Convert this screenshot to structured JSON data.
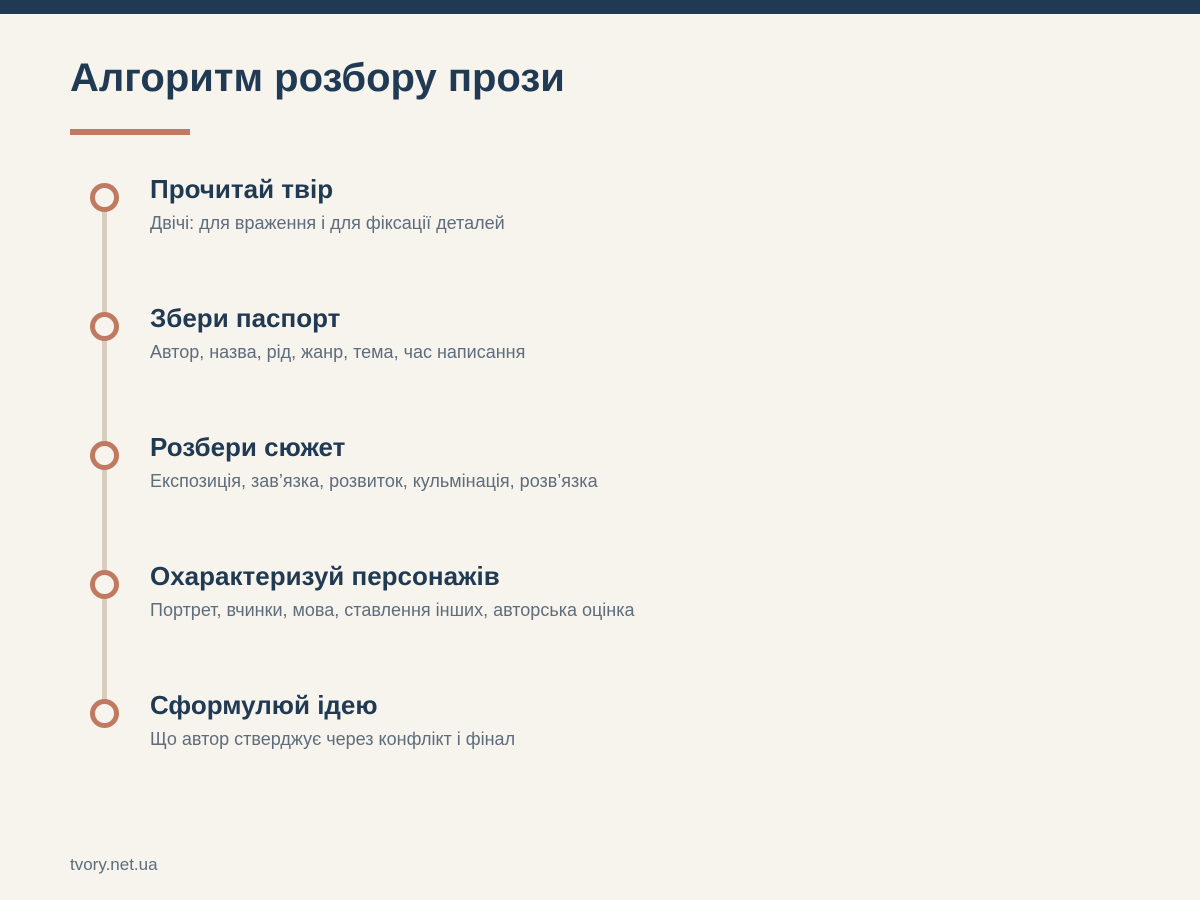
{
  "page": {
    "title": "Алгоритм розбору прози",
    "footer": "tvory.net.ua"
  },
  "colors": {
    "background": "#f7f3ed",
    "primary": "#1f3a52",
    "accent": "#c07a62",
    "muted_text": "#5d6d7c",
    "timeline_line": "#d6cdbf"
  },
  "steps": [
    {
      "title": "Прочитай твір",
      "description": "Двічі: для враження і для фіксації деталей"
    },
    {
      "title": "Збери паспорт",
      "description": "Автор, назва, рід, жанр, тема, час написання"
    },
    {
      "title": "Розбери сюжет",
      "description": "Експозиція, зав’язка, розвиток, кульмінація, розв’язка"
    },
    {
      "title": "Охарактеризуй персонажів",
      "description": "Портрет, вчинки, мова, ставлення інших, авторська оцінка"
    },
    {
      "title": "Сформулюй ідею",
      "description": "Що автор стверджує через конфлікт і фінал"
    }
  ]
}
